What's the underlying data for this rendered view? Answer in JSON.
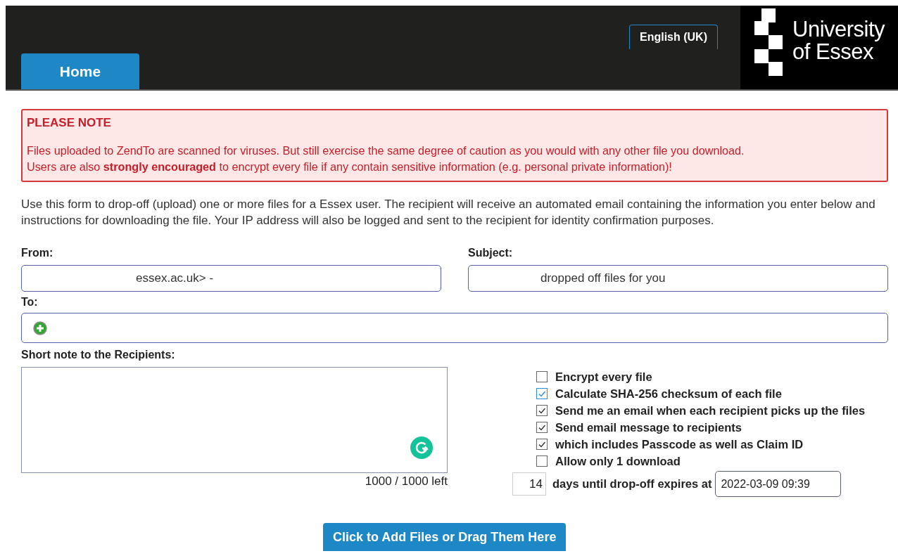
{
  "header": {
    "tabs": [
      {
        "label": "Home",
        "selected": true
      }
    ],
    "language": "English (UK)",
    "logo": {
      "line_1": "University",
      "line_2": "of Essex"
    }
  },
  "notice": {
    "title": "PLEASE NOTE",
    "lines": [
      "Files uploaded to ZendTo are scanned for viruses. But still exercise the same degree of caution as you would with any other file you download.",
      "Users are also **strongly encouraged** to encrypt every file if any contain sensitive information (e.g. personal private information)!"
    ]
  },
  "intro": "Use this form to drop-off (upload) one or more files for a Essex user. The recipient will receive an automated email containing the information you enter below and instructions for downloading the file. Your IP address will also be logged and sent to the recipient for identity confirmation purposes.",
  "from": {
    "label": "From:",
    "value": "essex.ac.uk> -"
  },
  "subject": {
    "label": "Subject:",
    "value": "dropped off files for you"
  },
  "to": {
    "label": "To:"
  },
  "note": {
    "label": "Short note to the Recipients:",
    "counter": "1000 / 1000 left"
  },
  "options": [
    {
      "label": "Encrypt every file",
      "checked": false,
      "focused": false
    },
    {
      "label": "Calculate SHA-256 checksum of each file",
      "checked": true,
      "focused": true
    },
    {
      "label": "Send me an email when each recipient picks up the files",
      "checked": true,
      "focused": false
    },
    {
      "label": "Send email message to recipients",
      "checked": true,
      "focused": false
    },
    {
      "label": "which includes Passcode as well as Claim ID",
      "checked": true,
      "focused": false
    },
    {
      "label": "Allow only 1 download",
      "checked": false,
      "focused": false
    }
  ],
  "expiry": {
    "days": "14",
    "label": "days until drop-off expires at",
    "date": "2022-03-09 09:39"
  },
  "upload_button": "Click to Add Files or Drag Them Here"
}
